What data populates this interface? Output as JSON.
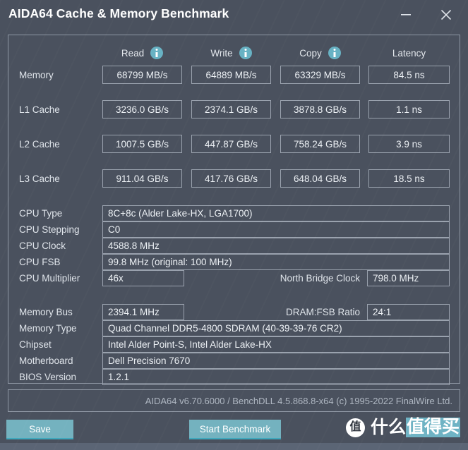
{
  "window": {
    "title": "AIDA64 Cache & Memory Benchmark",
    "minimize_label": "Minimize",
    "close_label": "Close"
  },
  "colors": {
    "background": "#4a515e",
    "accent_teal": "#74b2bf",
    "info_icon": "#68b2c4",
    "border": "#9aa2ae",
    "text": "#e8ecf0",
    "status_bar": "#5b6575"
  },
  "benchmark_table": {
    "columns": [
      {
        "label": "Read",
        "has_info_icon": true
      },
      {
        "label": "Write",
        "has_info_icon": true
      },
      {
        "label": "Copy",
        "has_info_icon": true
      },
      {
        "label": "Latency",
        "has_info_icon": false
      }
    ],
    "rows": [
      {
        "label": "Memory",
        "read": "68799 MB/s",
        "write": "64889 MB/s",
        "copy": "63329 MB/s",
        "latency": "84.5 ns"
      },
      {
        "label": "L1 Cache",
        "read": "3236.0 GB/s",
        "write": "2374.1 GB/s",
        "copy": "3878.8 GB/s",
        "latency": "1.1 ns"
      },
      {
        "label": "L2 Cache",
        "read": "1007.5 GB/s",
        "write": "447.87 GB/s",
        "copy": "758.24 GB/s",
        "latency": "3.9 ns"
      },
      {
        "label": "L3 Cache",
        "read": "911.04 GB/s",
        "write": "417.76 GB/s",
        "copy": "648.04 GB/s",
        "latency": "18.5 ns"
      }
    ]
  },
  "cpu_info": {
    "type_label": "CPU Type",
    "type_value": "8C+8c   (Alder Lake-HX, LGA1700)",
    "stepping_label": "CPU Stepping",
    "stepping_value": "C0",
    "clock_label": "CPU Clock",
    "clock_value": "4588.8 MHz",
    "fsb_label": "CPU FSB",
    "fsb_value": "99.8 MHz  (original: 100 MHz)",
    "multiplier_label": "CPU Multiplier",
    "multiplier_value": "46x",
    "north_bridge_label": "North Bridge Clock",
    "north_bridge_value": "798.0 MHz"
  },
  "memory_info": {
    "bus_label": "Memory Bus",
    "bus_value": "2394.1 MHz",
    "dram_fsb_label": "DRAM:FSB Ratio",
    "dram_fsb_value": "24:1",
    "type_label": "Memory Type",
    "type_value": "Quad Channel DDR5-4800 SDRAM  (40-39-39-76 CR2)",
    "chipset_label": "Chipset",
    "chipset_value": "Intel Alder Point-S, Intel Alder Lake-HX",
    "motherboard_label": "Motherboard",
    "motherboard_value": "Dell Precision 7670",
    "bios_label": "BIOS Version",
    "bios_value": "1.2.1"
  },
  "footer": {
    "credit": "AIDA64 v6.70.6000 / BenchDLL 4.5.868.8-x64  (c) 1995-2022 FinalWire Ltd.",
    "save_label": "Save",
    "start_label": "Start Benchmark"
  },
  "watermark": {
    "badge": "值",
    "text_plain": "什么",
    "text_highlighted": "值得买"
  }
}
